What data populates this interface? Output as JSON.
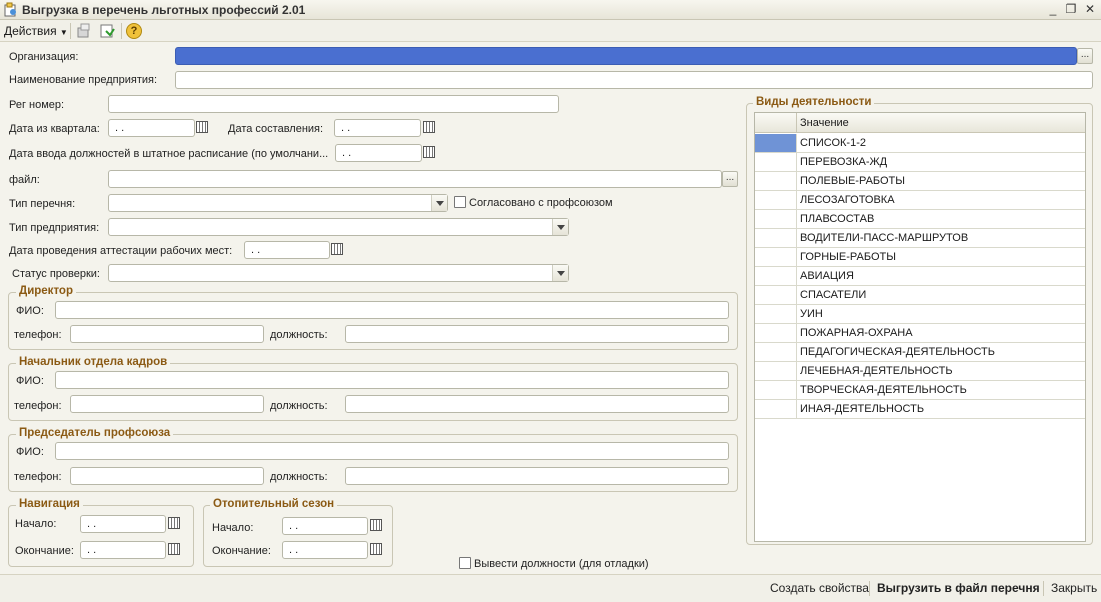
{
  "window": {
    "title": "Выгрузка в перечень льготных профессий 2.01",
    "minimize": "_",
    "restore": "❐",
    "close": "✕"
  },
  "toolbar": {
    "actions_label": "Действия",
    "help_label": "?"
  },
  "form": {
    "organization_label": "Организация:",
    "organization_value": "",
    "enterprise_name_label": "Наименование предприятия:",
    "enterprise_name_value": "",
    "reg_number_label": "Рег номер:",
    "reg_number_value": "",
    "quarter_date_label": "Дата из квартала:",
    "quarter_date_value": " .  .",
    "compile_date_label": "Дата составления:",
    "compile_date_value": " .  .",
    "staff_date_label": "Дата ввода должностей в штатное расписание (по умолчани...",
    "staff_date_value": " .  .",
    "file_label": "файл:",
    "file_value": "",
    "list_type_label": "Тип перечня:",
    "list_type_value": "",
    "union_agreed_label": "Согласовано с профсоюзом",
    "enterprise_type_label": "Тип предприятия:",
    "enterprise_type_value": "",
    "attestation_date_label": "Дата проведения аттестации рабочих мест:",
    "attestation_date_value": " .  .",
    "check_status_label": "Статус проверки:",
    "check_status_value": "",
    "ellipsis": "..."
  },
  "director": {
    "title": "Директор",
    "fio_label": "ФИО:",
    "phone_label": "телефон:",
    "position_label": "должность:"
  },
  "hr_head": {
    "title": "Начальник отдела кадров",
    "fio_label": "ФИО:",
    "phone_label": "телефон:",
    "position_label": "должность:"
  },
  "union_head": {
    "title": "Председатель профсоюза",
    "fio_label": "ФИО:",
    "phone_label": "телефон:",
    "position_label": "должность:"
  },
  "navigation": {
    "title": "Навигация",
    "start_label": "Начало:",
    "start_value": " .  .",
    "end_label": "Окончание:",
    "end_value": " .  ."
  },
  "heating": {
    "title": "Отопительный сезон",
    "start_label": "Начало:",
    "start_value": " .  .",
    "end_label": "Окончание:",
    "end_value": " .  ."
  },
  "debug_checkbox_label": "Вывести должности (для отладки)",
  "activities": {
    "title": "Виды деятельности",
    "column_header": "Значение",
    "rows": [
      "СПИСОК-1-2",
      "ПЕРЕВОЗКА-ЖД",
      "ПОЛЕВЫЕ-РАБОТЫ",
      "ЛЕСОЗАГОТОВКА",
      "ПЛАВСОСТАВ",
      "ВОДИТЕЛИ-ПАСС-МАРШРУТОВ",
      "ГОРНЫЕ-РАБОТЫ",
      "АВИАЦИЯ",
      "СПАСАТЕЛИ",
      "УИН",
      "ПОЖАРНАЯ-ОХРАНА",
      "ПЕДАГОГИЧЕСКАЯ-ДЕЯТЕЛЬНОСТЬ",
      "ЛЕЧЕБНАЯ-ДЕЯТЕЛЬНОСТЬ",
      "ТВОРЧЕСКАЯ-ДЕЯТЕЛЬНОСТЬ",
      "ИНАЯ-ДЕЯТЕЛЬНОСТЬ"
    ]
  },
  "bottom": {
    "create_props": "Создать свойства",
    "export": "Выгрузить в файл перечня",
    "close": "Закрыть"
  }
}
